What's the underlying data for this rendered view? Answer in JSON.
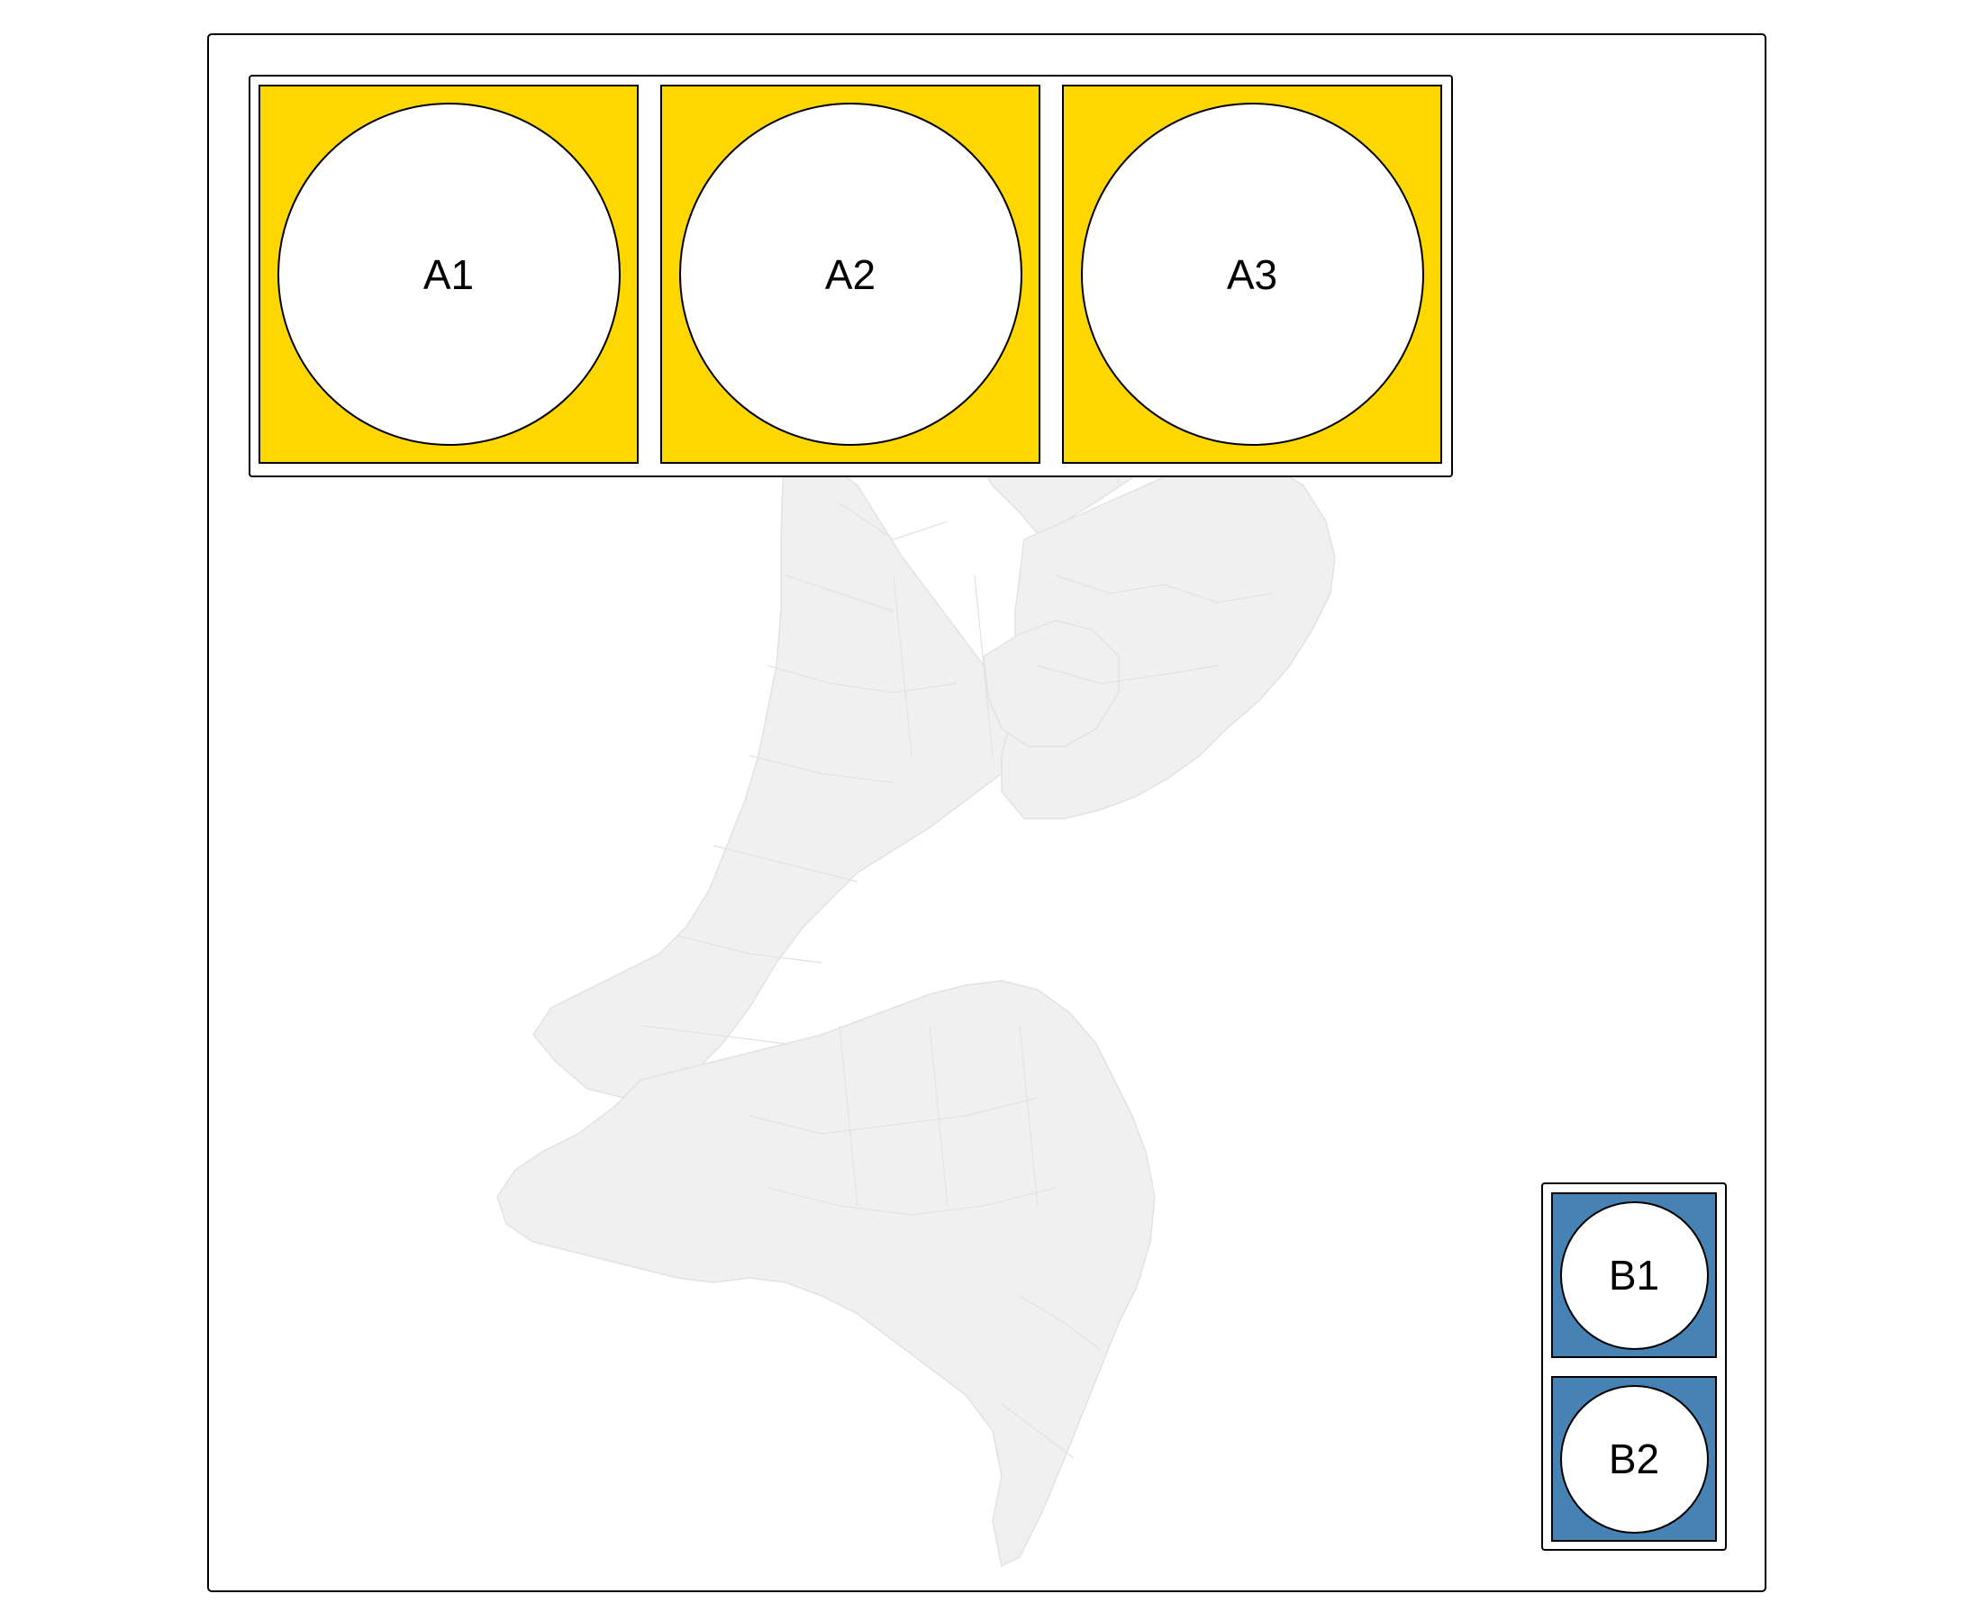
{
  "map": {
    "base_layer": "netherlands-municipalities-outline",
    "fill_color": "#f0f0f0",
    "border_color": "#e2e2e2",
    "frame_color": "#000000"
  },
  "legend_a": {
    "fill_color": "#FFD700",
    "items": [
      {
        "label": "A1"
      },
      {
        "label": "A2"
      },
      {
        "label": "A3"
      }
    ]
  },
  "legend_b": {
    "fill_color": "#4682B4",
    "items": [
      {
        "label": "B1"
      },
      {
        "label": "B2"
      }
    ]
  }
}
